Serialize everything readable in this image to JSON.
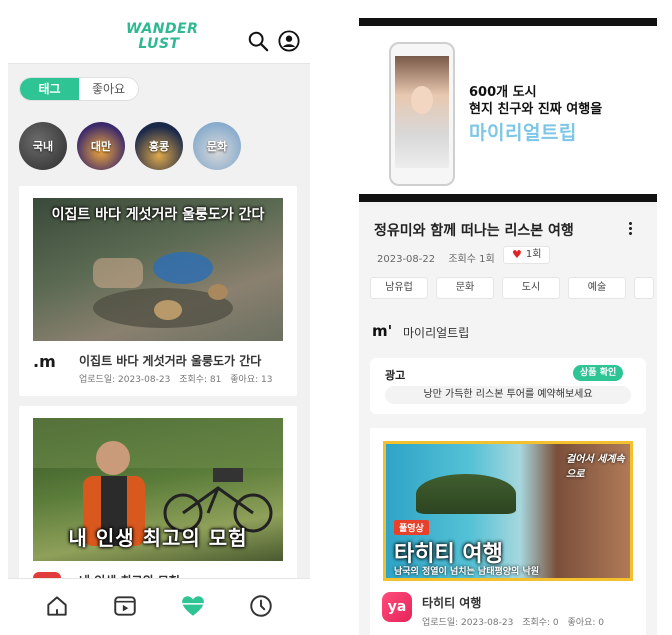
{
  "left": {
    "logo_line1": "WANDER",
    "logo_line2": "LUST",
    "toggle": {
      "active": "태그",
      "inactive": "좋아요"
    },
    "tags": [
      "국내",
      "대만",
      "홍콩",
      "문화"
    ],
    "cards": [
      {
        "thumb_caption": "이집트 바다 게섯거라 울룽도가 간다",
        "channel_logo": ".m",
        "title": "이집트 바다 게섯거라 울룽도가 간다",
        "upload_date": "업로드일: 2023-08-23",
        "views": "조회수: 81",
        "likes": "좋아요: 13"
      },
      {
        "thumb_caption": "내 인생 최고의 모험",
        "title": "내 인생 최고의 모험"
      }
    ]
  },
  "right": {
    "banner": {
      "line1": "600개 도시",
      "line2": "현지 친구와 진짜 여행을",
      "brand": "마이리얼트립"
    },
    "title": "정유미와 함께 떠나는 리스본 여행",
    "date": "2023-08-22",
    "views": "조회수 1회",
    "likes": "1회",
    "chips": [
      "남유럽",
      "문화",
      "도시",
      "예술"
    ],
    "channel": {
      "logo": "m'",
      "name": "마이리얼트립"
    },
    "ad": {
      "label": "광고",
      "button": "상품 확인",
      "text": "낭만 가득한 리스본 투어를 예약해보세요"
    },
    "video": {
      "badge": "풀영상",
      "big_text": "타히티 여행",
      "small_text": "남국의 정열이 넘치는 남태평양의 낙원",
      "corner_text": "걸어서 세계속으로",
      "logo": "ya",
      "title": "타히티 여행",
      "upload_date": "업로드일: 2023-08-23",
      "views": "조회수: 0",
      "likes": "좋아요: 0"
    }
  },
  "colors": {
    "accent": "#2fc494",
    "heart": "#e02424",
    "brand_blue": "#7ec6e6"
  }
}
